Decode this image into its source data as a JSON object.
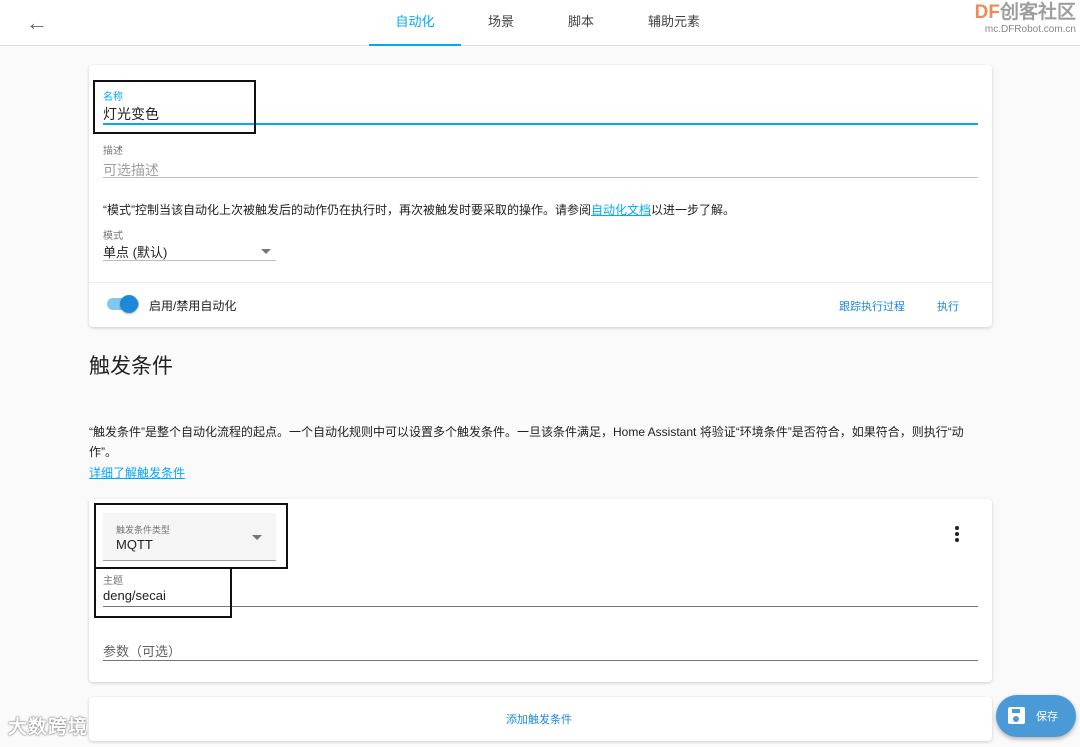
{
  "header": {
    "back_icon": "arrow-left-icon",
    "tabs": [
      {
        "label": "自动化"
      },
      {
        "label": "场景"
      },
      {
        "label": "脚本"
      },
      {
        "label": "辅助元素"
      }
    ],
    "watermark": {
      "prefix": "DF",
      "name": "创客社区",
      "url": "mc.DFRobot.com.cn"
    }
  },
  "automation": {
    "name_label": "名称",
    "name_value": "灯光变色",
    "description_label": "描述",
    "description_placeholder": "可选描述",
    "mode_help_before": "“模式”控制当该自动化上次被触发后的动作仍在执行时，再次被触发时要采取的操作。请参阅",
    "mode_help_link": "自动化文档",
    "mode_help_after": "以进一步了解。",
    "mode_label": "模式",
    "mode_value": "单点 (默认)",
    "enable_label": "启用/禁用自动化",
    "enabled": true,
    "trace_button": "跟踪执行过程",
    "run_button": "执行"
  },
  "triggers": {
    "title": "触发条件",
    "description_line1": "“触发条件”是整个自动化流程的起点。一个自动化规则中可以设置多个触发条件。一旦该条件满足，Home Assistant 将验证“环境条件”是否符合，如果符合，则执行“动",
    "description_line2": "作”。",
    "learn_more": "详细了解触发条件",
    "trigger_type_label": "触发条件类型",
    "trigger_type_value": "MQTT",
    "topic_label": "主题",
    "topic_value": "deng/secai",
    "payload_placeholder": "参数（可选）",
    "more_icon": "more-vertical-icon",
    "add_button": "添加触发条件"
  },
  "fab": {
    "label": "保存",
    "icon": "save-icon"
  },
  "bottom_watermark": "大数跨境"
}
